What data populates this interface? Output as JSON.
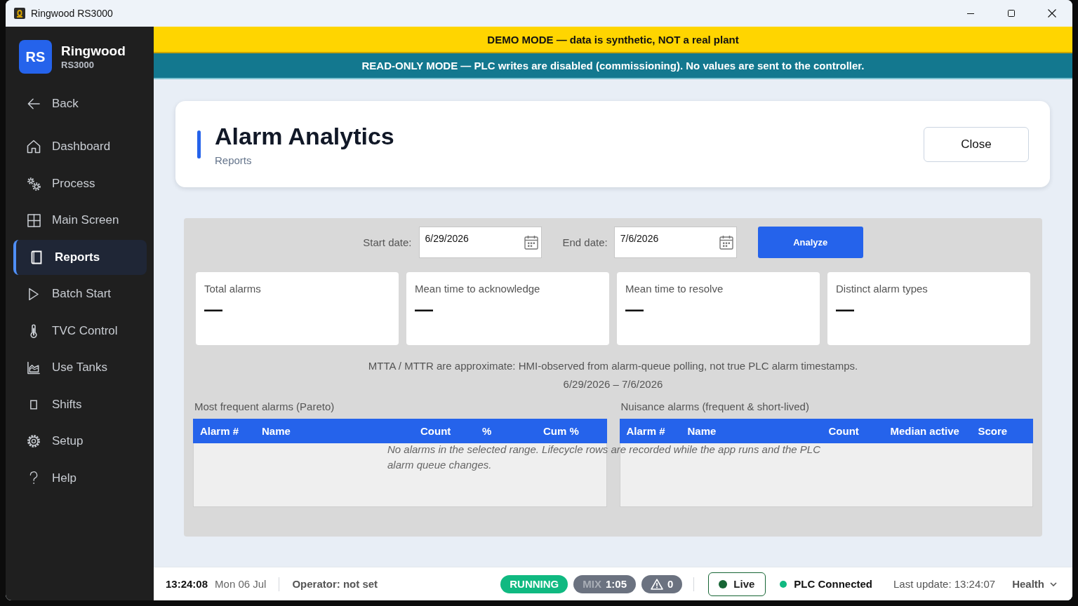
{
  "window": {
    "title": "Ringwood RS3000"
  },
  "sidebar": {
    "logo": "RS",
    "brand": "Ringwood",
    "model": "RS3000",
    "back": "Back",
    "items": [
      {
        "label": "Dashboard",
        "selected": false
      },
      {
        "label": "Process",
        "selected": false
      },
      {
        "label": "Main Screen",
        "selected": false
      },
      {
        "label": "Reports",
        "selected": true
      },
      {
        "label": "Batch Start",
        "selected": false
      },
      {
        "label": "TVC Control",
        "selected": false
      },
      {
        "label": "Use Tanks",
        "selected": false
      },
      {
        "label": "Shifts",
        "selected": false
      },
      {
        "label": "Setup",
        "selected": false
      },
      {
        "label": "Help",
        "selected": false
      }
    ]
  },
  "banners": [
    {
      "kind": "demo",
      "text": "DEMO MODE — data is synthetic, NOT a real plant"
    },
    {
      "kind": "readonly",
      "text": "READ-ONLY MODE — PLC writes are disabled (commissioning). No values are sent to the controller."
    }
  ],
  "header": {
    "title": "Alarm Analytics",
    "subtitle": "Reports",
    "close_button": "Close"
  },
  "filters": {
    "start_label": "Start date:",
    "start_value": "6/29/2026",
    "end_label": "End date:",
    "end_value": "7/6/2026",
    "analyze_button": "Analyze"
  },
  "stats": [
    {
      "label": "Total alarms",
      "value": "—"
    },
    {
      "label": "Mean time to acknowledge",
      "value": "—"
    },
    {
      "label": "Mean time to resolve",
      "value": "—"
    },
    {
      "label": "Distinct alarm types",
      "value": "—"
    }
  ],
  "note": "MTTA / MTTR are approximate: HMI-observed from alarm-queue polling, not true PLC alarm timestamps.",
  "range": "6/29/2026 – 7/6/2026",
  "tables": [
    {
      "title": "Most frequent alarms (Pareto)",
      "columns": [
        "Alarm #",
        "Name",
        "Count",
        "%",
        "Cum %"
      ]
    },
    {
      "title": "Nuisance alarms (frequent & short-lived)",
      "columns": [
        "Alarm #",
        "Name",
        "Count",
        "Median active",
        "Score"
      ]
    }
  ],
  "empty_message": "No alarms in the selected range. Lifecycle rows are recorded while the app runs and the PLC alarm queue changes.",
  "status_bar": {
    "time": "13:24:08",
    "date": "Mon 06 Jul",
    "operator": "Operator: not set",
    "pills": [
      {
        "kind": "state",
        "text": "RUNNING",
        "color": "#10b981"
      },
      {
        "kind": "timer",
        "label": "MIX",
        "text": "1:05",
        "color": "#6b7280"
      },
      {
        "kind": "alarms",
        "text": "0",
        "color": "#6b7280"
      }
    ],
    "live": {
      "label": "Live",
      "on": true
    },
    "plc": {
      "label": "PLC Connected",
      "connected": true
    },
    "last_update": "Last update: 13:24:07",
    "health": "Health"
  }
}
